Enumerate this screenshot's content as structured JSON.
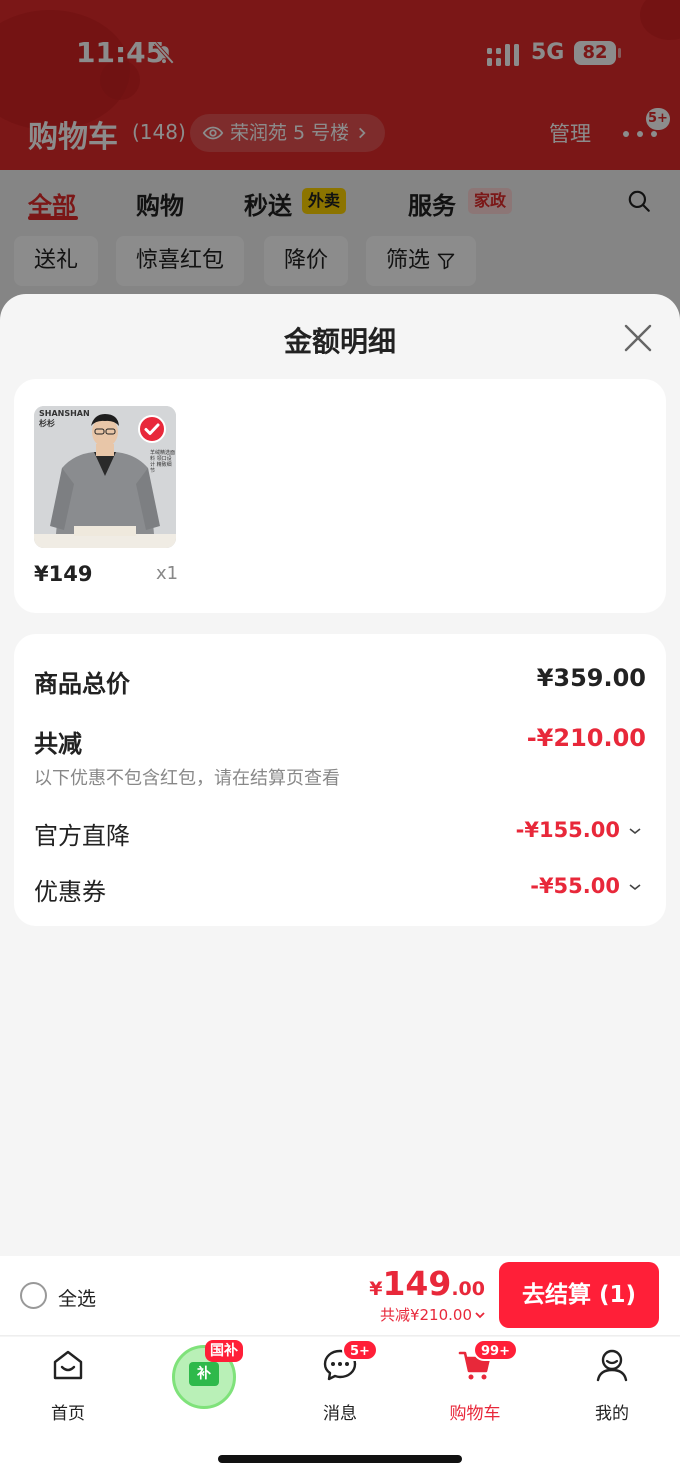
{
  "status": {
    "time": "11:45",
    "network": "5G",
    "battery": "82"
  },
  "cart": {
    "title": "购物车",
    "count": "(148)",
    "address": "荣润苑 5 号楼",
    "manage": "管理",
    "more_badge": "5+"
  },
  "tabs": [
    {
      "label": "全部"
    },
    {
      "label": "购物"
    },
    {
      "label": "秒送",
      "tag": "外卖"
    },
    {
      "label": "服务",
      "tag": "家政"
    }
  ],
  "chips": [
    "送礼",
    "惊喜红包",
    "降价",
    "筛选"
  ],
  "sheet": {
    "title": "金额明细",
    "product": {
      "brand": "SHANSHAN",
      "brand_cn": "杉杉",
      "image_note": "羊绒精选面料 领口设计 精致细节",
      "price": "¥149",
      "qty": "x1"
    },
    "summary": {
      "total_label": "商品总价",
      "total_value": "¥359.00",
      "reduce_label": "共减",
      "reduce_value": "-¥210.00",
      "note": "以下优惠不包含红包，请在结算页查看",
      "official_label": "官方直降",
      "official_value": "-¥155.00",
      "coupon_label": "优惠券",
      "coupon_value": "-¥55.00"
    }
  },
  "checkout": {
    "select_all": "全选",
    "currency": "¥",
    "price_int": "149",
    "price_dec": ".00",
    "saving": "共减¥210.00",
    "button": "去结算 (1)"
  },
  "nav": {
    "home": "首页",
    "subsidy_badge": "国补",
    "subsidy_icon_text": "补",
    "messages": "消息",
    "messages_badge": "5+",
    "cart": "购物车",
    "cart_badge": "99+",
    "mine": "我的"
  },
  "colors": {
    "brand_red": "#e02a2a",
    "price_red": "#e8283a",
    "button_red": "#ff1f38"
  }
}
